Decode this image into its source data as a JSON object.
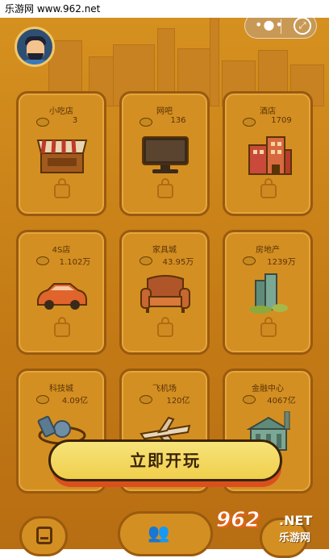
{
  "watermark": {
    "top_text": "乐游网 www.962.net",
    "bottom_962": "962",
    "bottom_net": ".NET",
    "bottom_site": "乐游网"
  },
  "header": {
    "capsule_menu_icon": "more-dots-icon",
    "capsule_close_icon": "expand-icon"
  },
  "cards": [
    {
      "name": "小吃店",
      "amount": "3",
      "icon": "snack-shop-icon"
    },
    {
      "name": "网吧",
      "amount": "136",
      "icon": "computer-monitor-icon"
    },
    {
      "name": "酒店",
      "amount": "1709",
      "icon": "hotel-building-icon"
    },
    {
      "name": "4S店",
      "amount": "1.102万",
      "icon": "car-icon"
    },
    {
      "name": "家具城",
      "amount": "43.95万",
      "icon": "armchair-icon"
    },
    {
      "name": "房地产",
      "amount": "1239万",
      "icon": "real-estate-buildings-icon"
    },
    {
      "name": "科技城",
      "amount": "4.09亿",
      "icon": "satellite-icon"
    },
    {
      "name": "飞机场",
      "amount": "120亿",
      "icon": "airplane-icon"
    },
    {
      "name": "金融中心",
      "amount": "4067亿",
      "icon": "finance-center-icon"
    }
  ],
  "play_button": {
    "label": "立即开玩"
  },
  "bottom_bar": {
    "left_icon": "document-icon",
    "middle_icon": "people-icon",
    "right_icon": "unknown-icon"
  },
  "colors": {
    "background": "#c8821a",
    "card": "#d48f22",
    "card_border": "#9a5a0e",
    "play_button": "#f0cf4c",
    "play_button_shadow": "#d9501e",
    "text_dark": "#5a3306"
  }
}
